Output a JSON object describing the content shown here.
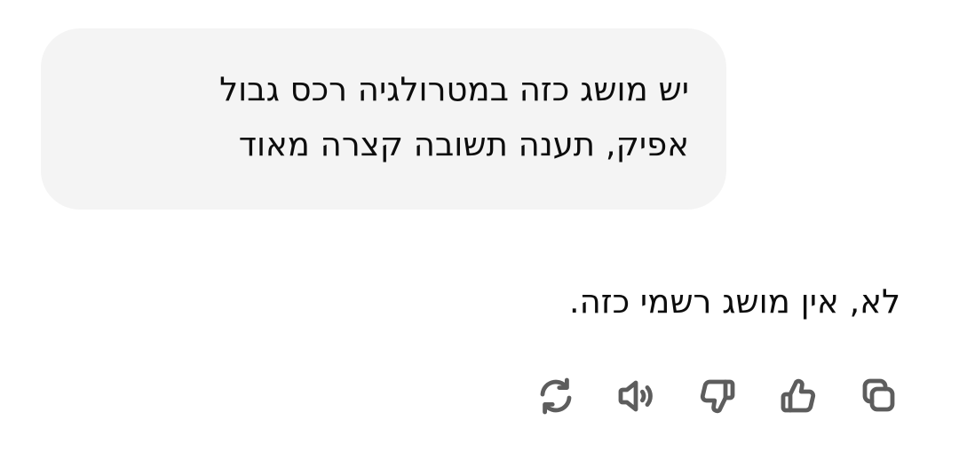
{
  "conversation": {
    "user_message": {
      "line_1": "יש מושג כזה במטרולגיה רכס גבול",
      "line_2": "אפיק, תענה תשובה קצרה מאוד"
    },
    "assistant_message": {
      "text": "לא, אין מושג רשמי כזה."
    },
    "actions": [
      {
        "icon": "copy-icon"
      },
      {
        "icon": "thumbs-up-icon"
      },
      {
        "icon": "thumbs-down-icon"
      },
      {
        "icon": "read-aloud-icon"
      },
      {
        "icon": "regenerate-icon"
      }
    ]
  },
  "colors": {
    "bubble_background": "#f4f4f4",
    "text": "#0d0d0d",
    "icon": "#5d5d5d"
  }
}
